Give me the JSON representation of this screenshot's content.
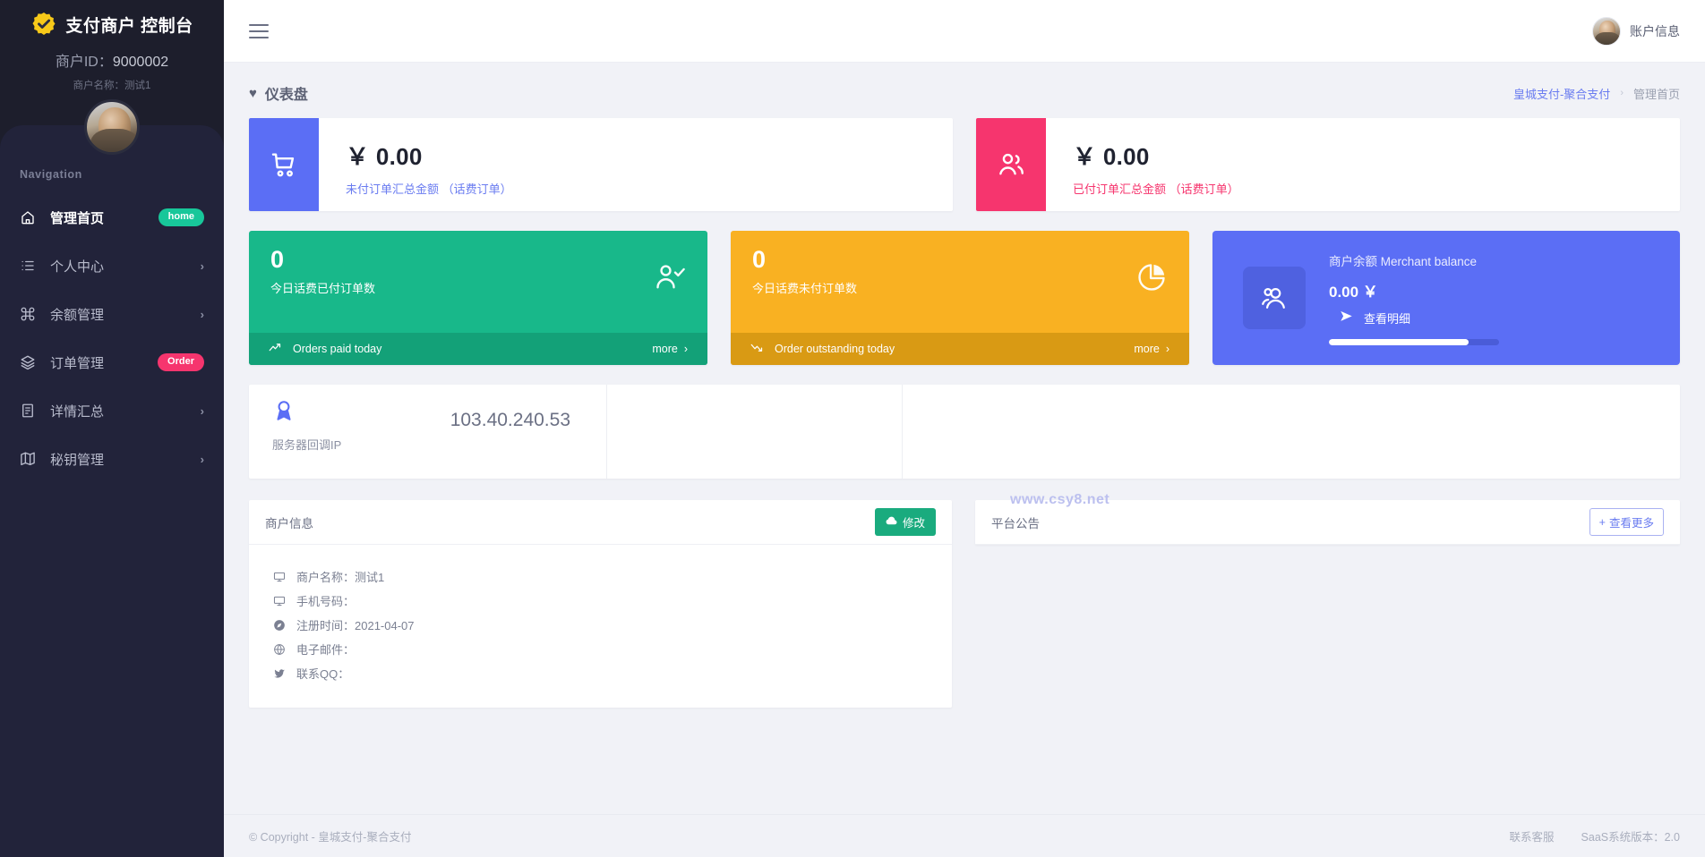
{
  "sidebar": {
    "brand_title": "支付商户 控制台",
    "brand_logo_icon": "shield-check-icon",
    "merchant_id_label": "商户ID：",
    "merchant_id_value": "9000002",
    "merchant_name_line": "商户名称：测试1",
    "nav_header": "Navigation",
    "items": [
      {
        "label": "管理首页",
        "icon": "home-icon",
        "badge": "home",
        "badge_type": "home",
        "active": true
      },
      {
        "label": "个人中心",
        "icon": "list-icon",
        "badge": "",
        "chevron": "›",
        "active": false
      },
      {
        "label": "余额管理",
        "icon": "command-icon",
        "badge": "",
        "chevron": "›",
        "active": false
      },
      {
        "label": "订单管理",
        "icon": "layers-icon",
        "badge": "Order",
        "badge_type": "order",
        "active": false
      },
      {
        "label": "详情汇总",
        "icon": "book-icon",
        "badge": "",
        "chevron": "›",
        "active": false
      },
      {
        "label": "秘钥管理",
        "icon": "map-icon",
        "badge": "",
        "chevron": "›",
        "active": false
      }
    ]
  },
  "topbar": {
    "menu_icon": "hamburger-icon",
    "user_label": "账户信息",
    "avatar_icon": "user-avatar"
  },
  "page": {
    "title": "仪表盘",
    "title_icon": "heart-icon",
    "breadcrumb": {
      "link": "皇城支付-聚合支付",
      "separator": "›",
      "current": "管理首页"
    }
  },
  "stats": [
    {
      "icon": "shopping-cart-icon",
      "amount": "￥ 0.00",
      "caption": "未付订单汇总金额 （话费订单）",
      "color": "#5b6ef5"
    },
    {
      "icon": "users-icon",
      "amount": "￥ 0.00",
      "caption": "已付订单汇总金额 （话费订单）",
      "color": "#f6356e"
    }
  ],
  "tiles": [
    {
      "number": "0",
      "subtitle": "今日话费已付订单数",
      "icon": "user-check-icon",
      "foot_icon": "trend-up-icon",
      "foot_label": "Orders paid today",
      "more_label": "more",
      "more_chevron": "›",
      "color": "#18b88a"
    },
    {
      "number": "0",
      "subtitle": "今日话费未付订单数",
      "icon": "pie-chart-icon",
      "foot_icon": "trend-down-icon",
      "foot_label": "Order outstanding today",
      "more_label": "more",
      "more_chevron": "›",
      "color": "#f9b122"
    }
  ],
  "balance": {
    "icon": "group-users-icon",
    "title": "商户余额 Merchant balance",
    "value": "0.00 ￥",
    "link_icon": "send-icon",
    "link_label": "查看明细",
    "progress_percent": 82,
    "color": "#5b6ef5"
  },
  "server": {
    "icon": "award-icon",
    "value": "103.40.240.53",
    "label": "服务器回调IP"
  },
  "watermark": "www.csy8.net",
  "merchant_panel": {
    "title": "商户信息",
    "modify_icon": "cloud-icon",
    "modify_label": "修改",
    "rows": [
      {
        "icon": "monitor-icon",
        "text": "商户名称：测试1"
      },
      {
        "icon": "monitor-icon",
        "text": "手机号码："
      },
      {
        "icon": "compass-icon",
        "text": "注册时间：2021-04-07"
      },
      {
        "icon": "globe-icon",
        "text": "电子邮件："
      },
      {
        "icon": "twitter-icon",
        "text": "联系QQ："
      }
    ]
  },
  "announcement_panel": {
    "title": "平台公告",
    "more_plus": "+",
    "more_label": "查看更多"
  },
  "footer": {
    "copyright": "© Copyright - 皇城支付-聚合支付",
    "support_label": "联系客服",
    "version_label": "SaaS系统版本：2.0"
  }
}
